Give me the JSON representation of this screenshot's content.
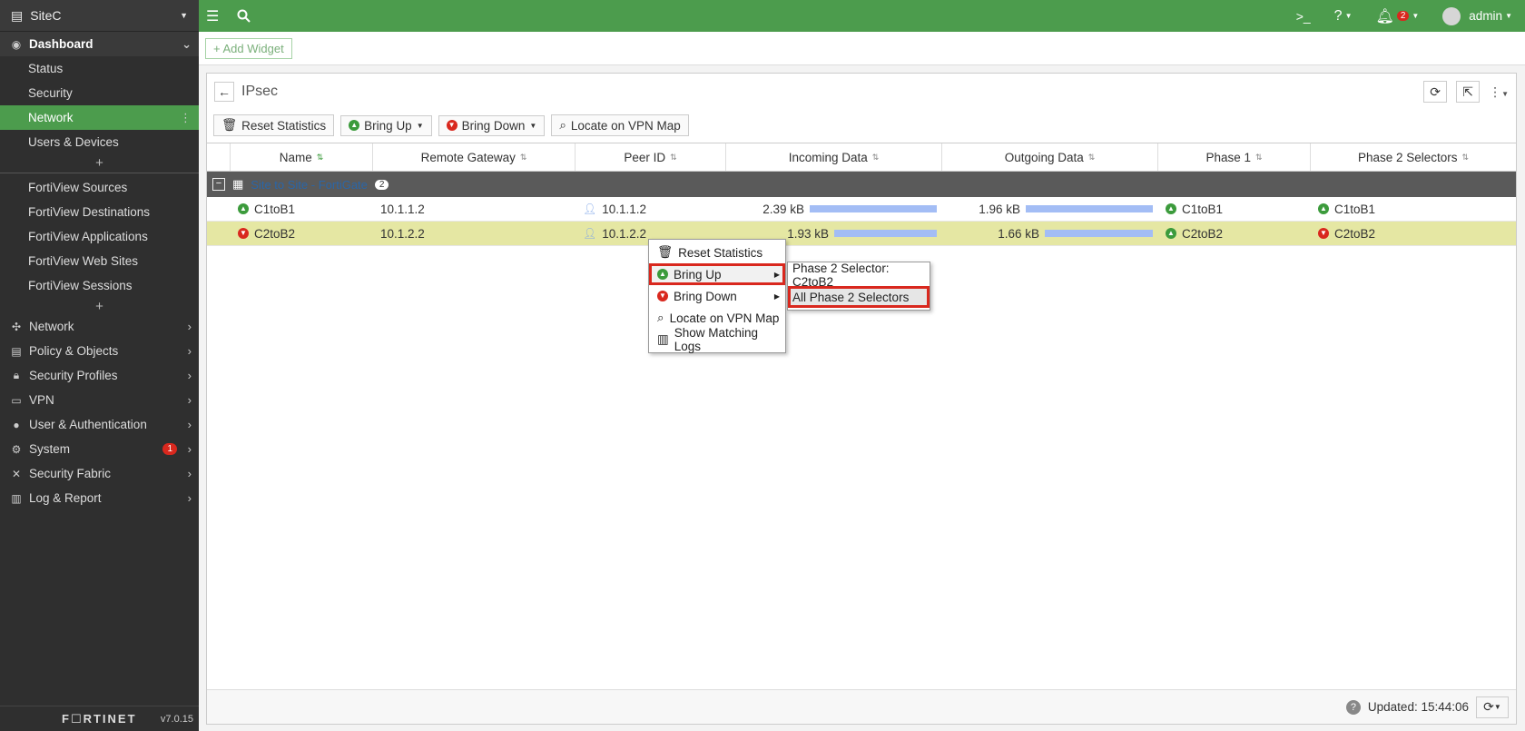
{
  "sidebar": {
    "site": "SiteC",
    "dashboard": "Dashboard",
    "dash_items": [
      "Status",
      "Security",
      "Network",
      "Users & Devices"
    ],
    "fortiview_items": [
      "FortiView Sources",
      "FortiView Destinations",
      "FortiView Applications",
      "FortiView Web Sites",
      "FortiView Sessions"
    ],
    "nav": {
      "network": "Network",
      "policy": "Policy & Objects",
      "security_profiles": "Security Profiles",
      "vpn": "VPN",
      "user_auth": "User & Authentication",
      "system": "System",
      "system_badge": "1",
      "fabric": "Security Fabric",
      "log": "Log & Report"
    },
    "logo": "F☐RTINET",
    "version": "v7.0.15"
  },
  "topbar": {
    "bell_count": "2",
    "user": "admin"
  },
  "add_widget": "Add Widget",
  "widget": {
    "title": "IPsec",
    "tools": {
      "reset": "Reset Statistics",
      "bring_up": "Bring Up",
      "bring_down": "Bring Down",
      "locate": "Locate on VPN Map"
    },
    "columns": [
      "Name",
      "Remote Gateway",
      "Peer ID",
      "Incoming Data",
      "Outgoing Data",
      "Phase 1",
      "Phase 2 Selectors"
    ],
    "group": {
      "label": "Site to Site - FortiGate",
      "count": "2"
    },
    "rows": [
      {
        "name": "C1toB1",
        "gateway": "10.1.1.2",
        "peer": "10.1.1.2",
        "incoming": "2.39 kB",
        "incoming_fraction": 1.0,
        "outgoing": "1.96 kB",
        "outgoing_fraction": 1.0,
        "phase1": "C1toB1",
        "phase2": "C1toB1",
        "status": "up"
      },
      {
        "name": "C2toB2",
        "gateway": "10.1.2.2",
        "peer": "10.1.2.2",
        "incoming": "1.93 kB",
        "incoming_fraction": 0.81,
        "outgoing": "1.66 kB",
        "outgoing_fraction": 0.85,
        "phase1": "C2toB2",
        "phase2": "C2toB2",
        "status": "down"
      }
    ],
    "updated": "Updated: 15:44:06"
  },
  "context_menu": {
    "reset": "Reset Statistics",
    "bring_up": "Bring Up",
    "bring_down": "Bring Down",
    "locate": "Locate on VPN Map",
    "logs": "Show Matching Logs"
  },
  "submenu": {
    "selector": "Phase 2 Selector: C2toB2",
    "all": "All Phase 2 Selectors"
  },
  "colors": {
    "brand_green": "#4c9c4d",
    "sidebar_bg": "#2f2f2f",
    "highlight_red": "#d9281e",
    "selected_row": "#e5e7a3",
    "bar_blue": "#a3bdf5"
  }
}
